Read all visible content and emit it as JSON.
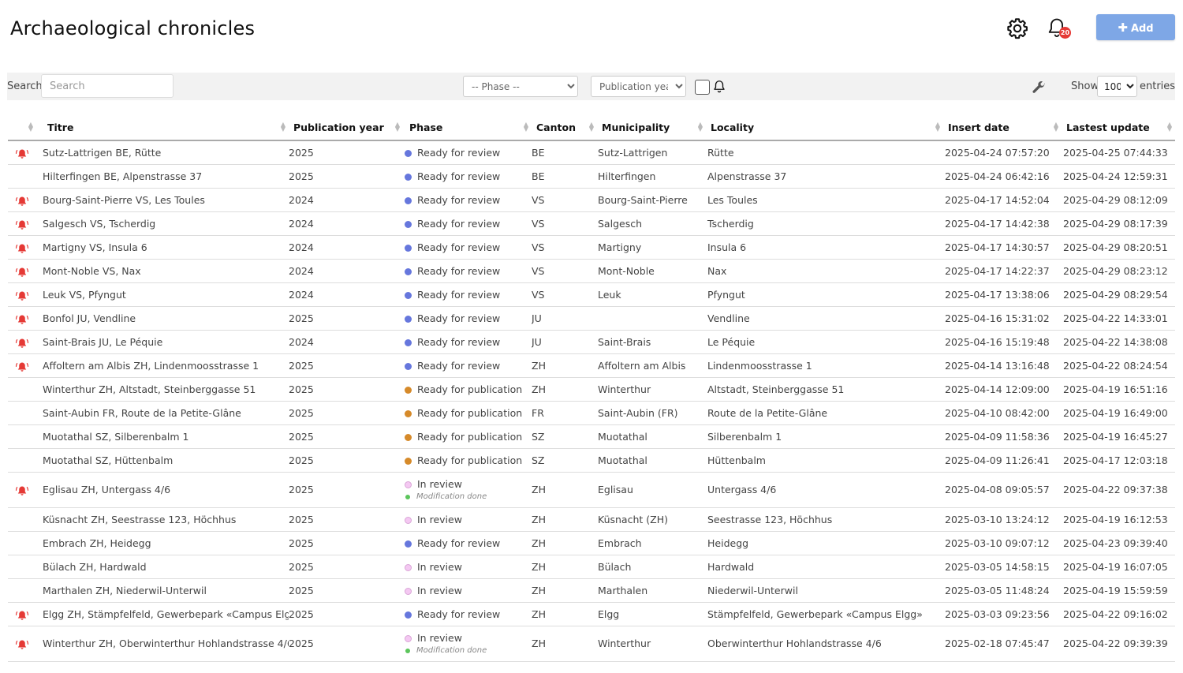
{
  "header": {
    "title": "Archaeological chronicles",
    "notification_count": "20",
    "add_label": "Add"
  },
  "filters": {
    "search_label": "Search:",
    "search_placeholder": "Search",
    "phase_placeholder": "-- Phase --",
    "year_placeholder": "Publication year",
    "show_label": "Show",
    "show_value": "100",
    "entries_label": "entries"
  },
  "colors": {
    "ready_for_review": "#6677dd",
    "ready_for_publication": "#d68a2a",
    "in_review": "#f4c8f2",
    "modification_done": "#5cc55c",
    "alarm": "#e53935",
    "add_button": "#7ea7e6"
  },
  "table": {
    "columns": [
      "Titre",
      "Publication year",
      "Phase",
      "Canton",
      "Municipality",
      "Locality",
      "Insert date",
      "Lastest update"
    ],
    "rows": [
      {
        "alarm": true,
        "titre": "Sutz-Lattrigen BE, Rütte",
        "year": "2025",
        "phase": "Ready for review",
        "phase_key": "review",
        "canton": "BE",
        "municipality": "Sutz-Lattrigen",
        "locality": "Rütte",
        "insert": "2025-04-24 07:57:20",
        "update": "2025-04-25 07:44:33"
      },
      {
        "alarm": false,
        "titre": "Hilterfingen BE, Alpenstrasse 37",
        "year": "2025",
        "phase": "Ready for review",
        "phase_key": "review",
        "canton": "BE",
        "municipality": "Hilterfingen",
        "locality": "Alpenstrasse 37",
        "insert": "2025-04-24 06:42:16",
        "update": "2025-04-24 12:59:31"
      },
      {
        "alarm": true,
        "titre": "Bourg-Saint-Pierre VS, Les Toules",
        "year": "2024",
        "phase": "Ready for review",
        "phase_key": "review",
        "canton": "VS",
        "municipality": "Bourg-Saint-Pierre",
        "locality": "Les Toules",
        "insert": "2025-04-17 14:52:04",
        "update": "2025-04-29 08:12:09"
      },
      {
        "alarm": true,
        "titre": "Salgesch VS, Tscherdig",
        "year": "2024",
        "phase": "Ready for review",
        "phase_key": "review",
        "canton": "VS",
        "municipality": "Salgesch",
        "locality": "Tscherdig",
        "insert": "2025-04-17 14:42:38",
        "update": "2025-04-29 08:17:39"
      },
      {
        "alarm": true,
        "titre": "Martigny VS, Insula 6",
        "year": "2024",
        "phase": "Ready for review",
        "phase_key": "review",
        "canton": "VS",
        "municipality": "Martigny",
        "locality": "Insula 6",
        "insert": "2025-04-17 14:30:57",
        "update": "2025-04-29 08:20:51"
      },
      {
        "alarm": true,
        "titre": "Mont-Noble VS, Nax",
        "year": "2024",
        "phase": "Ready for review",
        "phase_key": "review",
        "canton": "VS",
        "municipality": "Mont-Noble",
        "locality": "Nax",
        "insert": "2025-04-17 14:22:37",
        "update": "2025-04-29 08:23:12"
      },
      {
        "alarm": true,
        "titre": "Leuk VS, Pfyngut",
        "year": "2024",
        "phase": "Ready for review",
        "phase_key": "review",
        "canton": "VS",
        "municipality": "Leuk",
        "locality": "Pfyngut",
        "insert": "2025-04-17 13:38:06",
        "update": "2025-04-29 08:29:54"
      },
      {
        "alarm": true,
        "titre": "Bonfol JU, Vendline",
        "year": "2025",
        "phase": "Ready for review",
        "phase_key": "review",
        "canton": "JU",
        "municipality": "",
        "locality": "Vendline",
        "insert": "2025-04-16 15:31:02",
        "update": "2025-04-22 14:33:01"
      },
      {
        "alarm": true,
        "titre": "Saint-Brais JU, Le Péquie",
        "year": "2024",
        "phase": "Ready for review",
        "phase_key": "review",
        "canton": "JU",
        "municipality": "Saint-Brais",
        "locality": "Le Péquie",
        "insert": "2025-04-16 15:19:48",
        "update": "2025-04-22 14:38:08"
      },
      {
        "alarm": true,
        "titre": "Affoltern am Albis ZH, Lindenmoosstrasse 1",
        "year": "2025",
        "phase": "Ready for review",
        "phase_key": "review",
        "canton": "ZH",
        "municipality": "Affoltern am Albis",
        "locality": "Lindenmoosstrasse 1",
        "insert": "2025-04-14 13:16:48",
        "update": "2025-04-22 08:24:54"
      },
      {
        "alarm": false,
        "titre": "Winterthur ZH, Altstadt, Steinberggasse 51",
        "year": "2025",
        "phase": "Ready for publication",
        "phase_key": "pub",
        "canton": "ZH",
        "municipality": "Winterthur",
        "locality": "Altstadt, Steinberggasse 51",
        "insert": "2025-04-14 12:09:00",
        "update": "2025-04-19 16:51:16"
      },
      {
        "alarm": false,
        "titre": "Saint-Aubin FR, Route de la Petite-Glâne",
        "year": "2025",
        "phase": "Ready for publication",
        "phase_key": "pub",
        "canton": "FR",
        "municipality": "Saint-Aubin (FR)",
        "locality": "Route de la Petite-Glâne",
        "insert": "2025-04-10 08:42:00",
        "update": "2025-04-19 16:49:00"
      },
      {
        "alarm": false,
        "titre": "Muotathal SZ, Silberenbalm 1",
        "year": "2025",
        "phase": "Ready for publication",
        "phase_key": "pub",
        "canton": "SZ",
        "municipality": "Muotathal",
        "locality": "Silberenbalm 1",
        "insert": "2025-04-09 11:58:36",
        "update": "2025-04-19 16:45:27"
      },
      {
        "alarm": false,
        "titre": "Muotathal SZ, Hüttenbalm",
        "year": "2025",
        "phase": "Ready for publication",
        "phase_key": "pub",
        "canton": "SZ",
        "municipality": "Muotathal",
        "locality": "Hüttenbalm",
        "insert": "2025-04-09 11:26:41",
        "update": "2025-04-17 12:03:18"
      },
      {
        "alarm": true,
        "titre": "Eglisau ZH, Untergass 4/6",
        "year": "2025",
        "phase": "In review",
        "phase_key": "inrev",
        "sub": "Modification done",
        "canton": "ZH",
        "municipality": "Eglisau",
        "locality": "Untergass 4/6",
        "insert": "2025-04-08 09:05:57",
        "update": "2025-04-22 09:37:38"
      },
      {
        "alarm": false,
        "titre": "Küsnacht ZH, Seestrasse 123, Höchhus",
        "year": "2025",
        "phase": "In review",
        "phase_key": "inrev",
        "canton": "ZH",
        "municipality": "Küsnacht (ZH)",
        "locality": "Seestrasse 123, Höchhus",
        "insert": "2025-03-10 13:24:12",
        "update": "2025-04-19 16:12:53"
      },
      {
        "alarm": false,
        "titre": "Embrach ZH, Heidegg",
        "year": "2025",
        "phase": "Ready for review",
        "phase_key": "review",
        "canton": "ZH",
        "municipality": "Embrach",
        "locality": "Heidegg",
        "insert": "2025-03-10 09:07:12",
        "update": "2025-04-23 09:39:40"
      },
      {
        "alarm": false,
        "titre": "Bülach ZH, Hardwald",
        "year": "2025",
        "phase": "In review",
        "phase_key": "inrev",
        "canton": "ZH",
        "municipality": "Bülach",
        "locality": "Hardwald",
        "insert": "2025-03-05 14:58:15",
        "update": "2025-04-19 16:07:05"
      },
      {
        "alarm": false,
        "titre": "Marthalen ZH, Niederwil-Unterwil",
        "year": "2025",
        "phase": "In review",
        "phase_key": "inrev",
        "canton": "ZH",
        "municipality": "Marthalen",
        "locality": "Niederwil-Unterwil",
        "insert": "2025-03-05 11:48:24",
        "update": "2025-04-19 15:59:59"
      },
      {
        "alarm": true,
        "titre": "Elgg ZH, Stämpfelfeld, Gewerbepark «Campus Elgg»",
        "year": "2025",
        "phase": "Ready for review",
        "phase_key": "review",
        "canton": "ZH",
        "municipality": "Elgg",
        "locality": "Stämpfelfeld, Gewerbepark «Campus Elgg»",
        "insert": "2025-03-03 09:23:56",
        "update": "2025-04-22 09:16:02"
      },
      {
        "alarm": true,
        "titre": "Winterthur ZH, Oberwinterthur Hohlandstrasse 4/6",
        "year": "2025",
        "phase": "In review",
        "phase_key": "inrev",
        "sub": "Modification done",
        "canton": "ZH",
        "municipality": "Winterthur",
        "locality": "Oberwinterthur Hohlandstrasse 4/6",
        "insert": "2025-02-18 07:45:47",
        "update": "2025-04-22 09:39:39"
      }
    ]
  }
}
